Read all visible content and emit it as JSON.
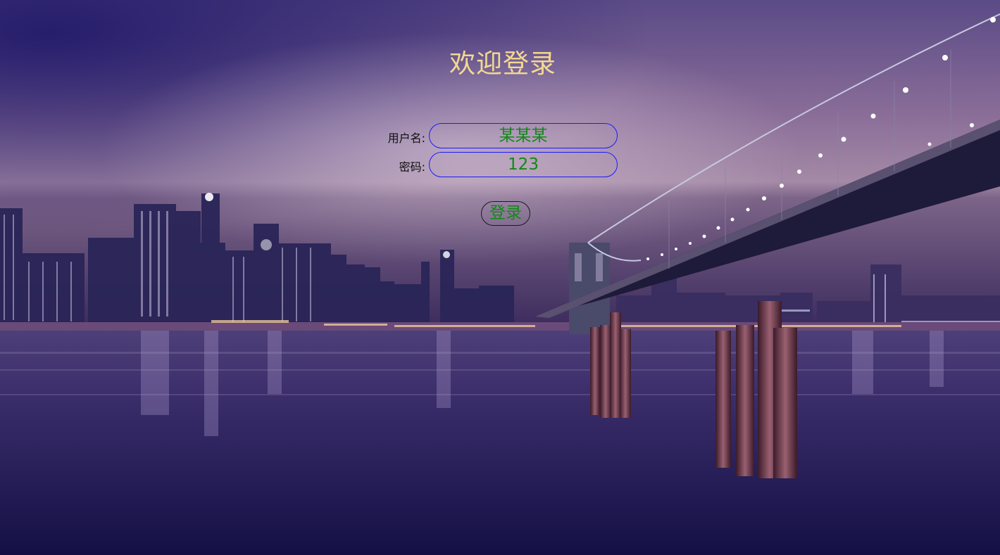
{
  "page": {
    "title": "欢迎登录"
  },
  "form": {
    "username_label": "用户名:",
    "username_value": "某某某",
    "password_label": "密码:",
    "password_value": "123",
    "submit_label": "登录"
  },
  "colors": {
    "title": "#f3d891",
    "field_text": "#0f8a14",
    "field_border": "#1a1aff",
    "label_text": "#111111"
  }
}
